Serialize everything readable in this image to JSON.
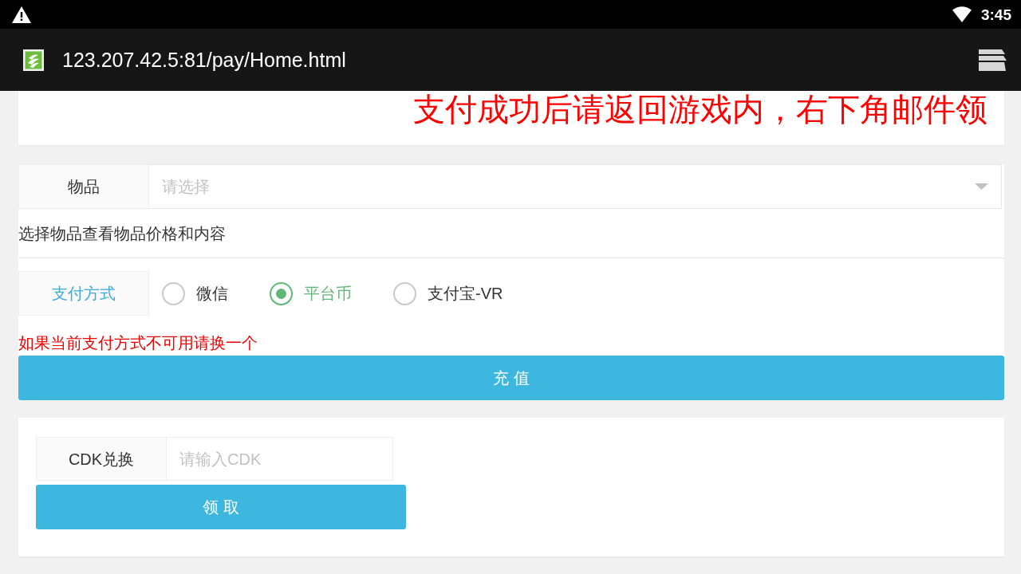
{
  "status_bar": {
    "time": "3:45"
  },
  "browser": {
    "url": "123.207.42.5:81/pay/Home.html"
  },
  "notice": {
    "text": "支付成功后请返回游戏内，右下角邮件领"
  },
  "item_select": {
    "label": "物品",
    "placeholder": "请选择"
  },
  "item_hint": "选择物品查看物品价格和内容",
  "payment": {
    "label": "支付方式",
    "options": [
      {
        "label": "微信",
        "selected": false
      },
      {
        "label": "平台币",
        "selected": true
      },
      {
        "label": "支付宝-VR",
        "selected": false
      }
    ]
  },
  "payment_warning": "如果当前支付方式不可用请换一个",
  "recharge_button": "充 值",
  "cdk": {
    "label": "CDK兑换",
    "placeholder": "请输入CDK",
    "button": "领 取"
  }
}
